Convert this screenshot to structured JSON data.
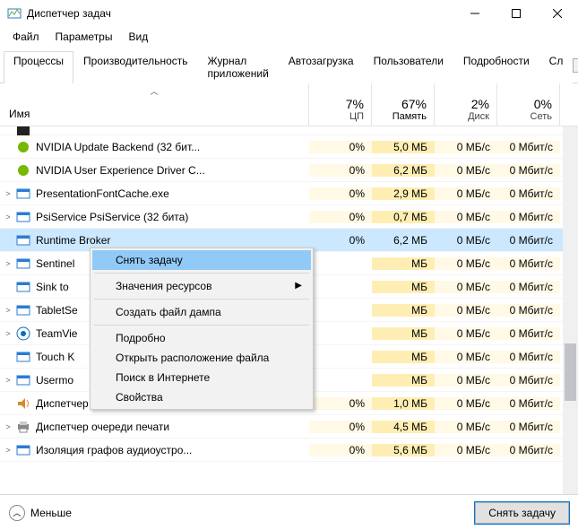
{
  "window": {
    "title": "Диспетчер задач"
  },
  "menu": {
    "file": "Файл",
    "options": "Параметры",
    "view": "Вид"
  },
  "tabs": {
    "items": [
      "Процессы",
      "Производительность",
      "Журнал приложений",
      "Автозагрузка",
      "Пользователи",
      "Подробности",
      "Сл"
    ],
    "active": 0
  },
  "columns": {
    "name": "Имя",
    "cpu": {
      "pct": "7%",
      "label": "ЦП"
    },
    "mem": {
      "pct": "67%",
      "label": "Память"
    },
    "disk": {
      "pct": "2%",
      "label": "Диск"
    },
    "net": {
      "pct": "0%",
      "label": "Сеть"
    }
  },
  "rows": [
    {
      "exp": "",
      "icon": "black",
      "name": "",
      "cpu": "",
      "mem": "",
      "disk": "",
      "net": "",
      "partial": true
    },
    {
      "exp": "",
      "icon": "nvidia",
      "name": "NVIDIA Update Backend (32 бит...",
      "cpu": "0%",
      "mem": "5,0 МБ",
      "disk": "0 МБ/с",
      "net": "0 Мбит/с"
    },
    {
      "exp": "",
      "icon": "nvidia",
      "name": "NVIDIA User Experience Driver C...",
      "cpu": "0%",
      "mem": "6,2 МБ",
      "disk": "0 МБ/с",
      "net": "0 Мбит/с"
    },
    {
      "exp": ">",
      "icon": "svc",
      "name": "PresentationFontCache.exe",
      "cpu": "0%",
      "mem": "2,9 МБ",
      "disk": "0 МБ/с",
      "net": "0 Мбит/с"
    },
    {
      "exp": ">",
      "icon": "svc",
      "name": "PsiService PsiService (32 бита)",
      "cpu": "0%",
      "mem": "0,7 МБ",
      "disk": "0 МБ/с",
      "net": "0 Мбит/с"
    },
    {
      "exp": "",
      "icon": "svc",
      "name": "Runtime Broker",
      "cpu": "0%",
      "mem": "6,2 МБ",
      "disk": "0 МБ/с",
      "net": "0 Мбит/с",
      "selected": true
    },
    {
      "exp": ">",
      "icon": "svc",
      "name": "Sentinel",
      "cpu": "",
      "mem": "МБ",
      "disk": "0 МБ/с",
      "net": "0 Мбит/с"
    },
    {
      "exp": "",
      "icon": "svc",
      "name": "Sink to ",
      "cpu": "",
      "mem": "МБ",
      "disk": "0 МБ/с",
      "net": "0 Мбит/с"
    },
    {
      "exp": ">",
      "icon": "svc",
      "name": "TabletSe",
      "cpu": "",
      "mem": "МБ",
      "disk": "0 МБ/с",
      "net": "0 Мбит/с"
    },
    {
      "exp": ">",
      "icon": "tv",
      "name": "TeamVie",
      "cpu": "",
      "mem": "МБ",
      "disk": "0 МБ/с",
      "net": "0 Мбит/с"
    },
    {
      "exp": "",
      "icon": "svc",
      "name": "Touch K",
      "cpu": "",
      "mem": "МБ",
      "disk": "0 МБ/с",
      "net": "0 Мбит/с"
    },
    {
      "exp": ">",
      "icon": "svc",
      "name": "Usermo",
      "cpu": "",
      "mem": "МБ",
      "disk": "0 МБ/с",
      "net": "0 Мбит/с"
    },
    {
      "exp": "",
      "icon": "snd",
      "name": "Диспетчер Realtek HD",
      "cpu": "0%",
      "mem": "1,0 МБ",
      "disk": "0 МБ/с",
      "net": "0 Мбит/с"
    },
    {
      "exp": ">",
      "icon": "prn",
      "name": "Диспетчер очереди печати",
      "cpu": "0%",
      "mem": "4,5 МБ",
      "disk": "0 МБ/с",
      "net": "0 Мбит/с"
    },
    {
      "exp": ">",
      "icon": "svc",
      "name": "Изоляция графов аудиоустро...",
      "cpu": "0%",
      "mem": "5,6 МБ",
      "disk": "0 МБ/с",
      "net": "0 Мбит/с"
    }
  ],
  "context_menu": {
    "end_task": "Снять задачу",
    "resource_values": "Значения ресурсов",
    "create_dump": "Создать файл дампа",
    "details": "Подробно",
    "open_location": "Открыть расположение файла",
    "search_online": "Поиск в Интернете",
    "properties": "Свойства"
  },
  "footer": {
    "less": "Меньше",
    "end_task": "Снять задачу"
  }
}
